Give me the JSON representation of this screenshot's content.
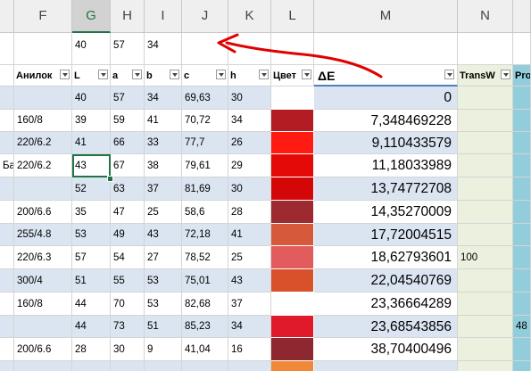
{
  "columns": [
    "F",
    "G",
    "H",
    "I",
    "J",
    "K",
    "L",
    "M",
    "N",
    ""
  ],
  "selected_column": "G",
  "header_row": {
    "F": "Анилок",
    "G": "L",
    "H": "a",
    "I": "b",
    "J": "c",
    "K": "h",
    "L": "Цвет",
    "M": "ΔE",
    "N": "TransW",
    "O": "Pro"
  },
  "ref_row": {
    "G": "40",
    "H": "57",
    "I": "34"
  },
  "colors": {
    "row_band": "#dbe5f1",
    "light_green": "#ebf1de",
    "teal": "#92cddc",
    "annotation": "#e00000",
    "select_green": "#217346"
  },
  "rows": [
    {
      "E": "",
      "F": "",
      "G": "40",
      "H": "57",
      "I": "34",
      "J": "69,63",
      "K": "30",
      "color": "",
      "M": "0",
      "N": "",
      "O": ""
    },
    {
      "E": "",
      "F": "160/8",
      "G": "39",
      "H": "59",
      "I": "41",
      "J": "70,72",
      "K": "34",
      "color": "#b41c24",
      "M": "7,348469228",
      "N": "",
      "O": ""
    },
    {
      "E": "",
      "F": "220/6.2",
      "G": "41",
      "H": "66",
      "I": "33",
      "J": "77,7",
      "K": "26",
      "color": "#ff1a12",
      "M": "9,110433579",
      "N": "",
      "O": ""
    },
    {
      "E": "Ба",
      "F": "220/6.2",
      "G": "43",
      "H": "67",
      "I": "38",
      "J": "79,61",
      "K": "29",
      "color": "#e40a08",
      "M": "11,18033989",
      "N": "",
      "O": ""
    },
    {
      "E": "",
      "F": "",
      "G": "52",
      "H": "63",
      "I": "37",
      "J": "81,69",
      "K": "30",
      "color": "#d40708",
      "M": "13,74772708",
      "N": "",
      "O": ""
    },
    {
      "E": "",
      "F": "200/6.6",
      "G": "35",
      "H": "47",
      "I": "25",
      "J": "58,6",
      "K": "28",
      "color": "#9c2a30",
      "M": "14,35270009",
      "N": "",
      "O": ""
    },
    {
      "E": "",
      "F": "255/4.8",
      "G": "53",
      "H": "49",
      "I": "43",
      "J": "72,18",
      "K": "41",
      "color": "#d5593a",
      "M": "17,72004515",
      "N": "",
      "O": ""
    },
    {
      "E": "",
      "F": "220/6.3",
      "G": "57",
      "H": "54",
      "I": "27",
      "J": "78,52",
      "K": "25",
      "color": "#e25c5e",
      "M": "18,62793601",
      "N": "100",
      "O": ""
    },
    {
      "E": "",
      "F": "300/4",
      "G": "51",
      "H": "55",
      "I": "53",
      "J": "75,01",
      "K": "43",
      "color": "#d9512a",
      "M": "22,04540769",
      "N": "",
      "O": ""
    },
    {
      "E": "",
      "F": "160/8",
      "G": "44",
      "H": "70",
      "I": "53",
      "J": "82,68",
      "K": "37",
      "color": "",
      "M": "23,36664289",
      "N": "",
      "O": ""
    },
    {
      "E": "",
      "F": "",
      "G": "44",
      "H": "73",
      "I": "51",
      "J": "85,23",
      "K": "34",
      "color": "#e01a2a",
      "M": "23,68543856",
      "N": "",
      "O": "48"
    },
    {
      "E": "",
      "F": "200/6.6",
      "G": "28",
      "H": "30",
      "I": "9",
      "J": "41,04",
      "K": "16",
      "color": "#8e2830",
      "M": "38,70400496",
      "N": "",
      "O": ""
    },
    {
      "E": "",
      "F": "",
      "G": "",
      "H": "",
      "I": "",
      "J": "",
      "K": "",
      "color": "#f0883a",
      "M": "",
      "N": "",
      "O": ""
    }
  ]
}
